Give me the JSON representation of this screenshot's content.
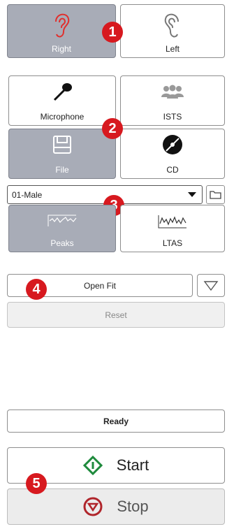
{
  "ear": {
    "right_label": "Right",
    "left_label": "Left"
  },
  "source": {
    "microphone_label": "Microphone",
    "ists_label": "ISTS",
    "file_label": "File",
    "cd_label": "CD"
  },
  "file_select": {
    "value": "01-Male"
  },
  "analysis": {
    "peaks_label": "Peaks",
    "ltas_label": "LTAS"
  },
  "fit": {
    "open_fit_label": "Open Fit",
    "reset_label": "Reset"
  },
  "status": {
    "text": "Ready"
  },
  "controls": {
    "start_label": "Start",
    "stop_label": "Stop"
  },
  "callouts": [
    "1",
    "2",
    "3",
    "4",
    "5"
  ],
  "colors": {
    "selected_bg": "#a8acb7",
    "callout_red": "#d7191f",
    "right_ear_red": "#e0302e",
    "start_green": "#1e8a3c",
    "stop_red": "#b0252b"
  }
}
